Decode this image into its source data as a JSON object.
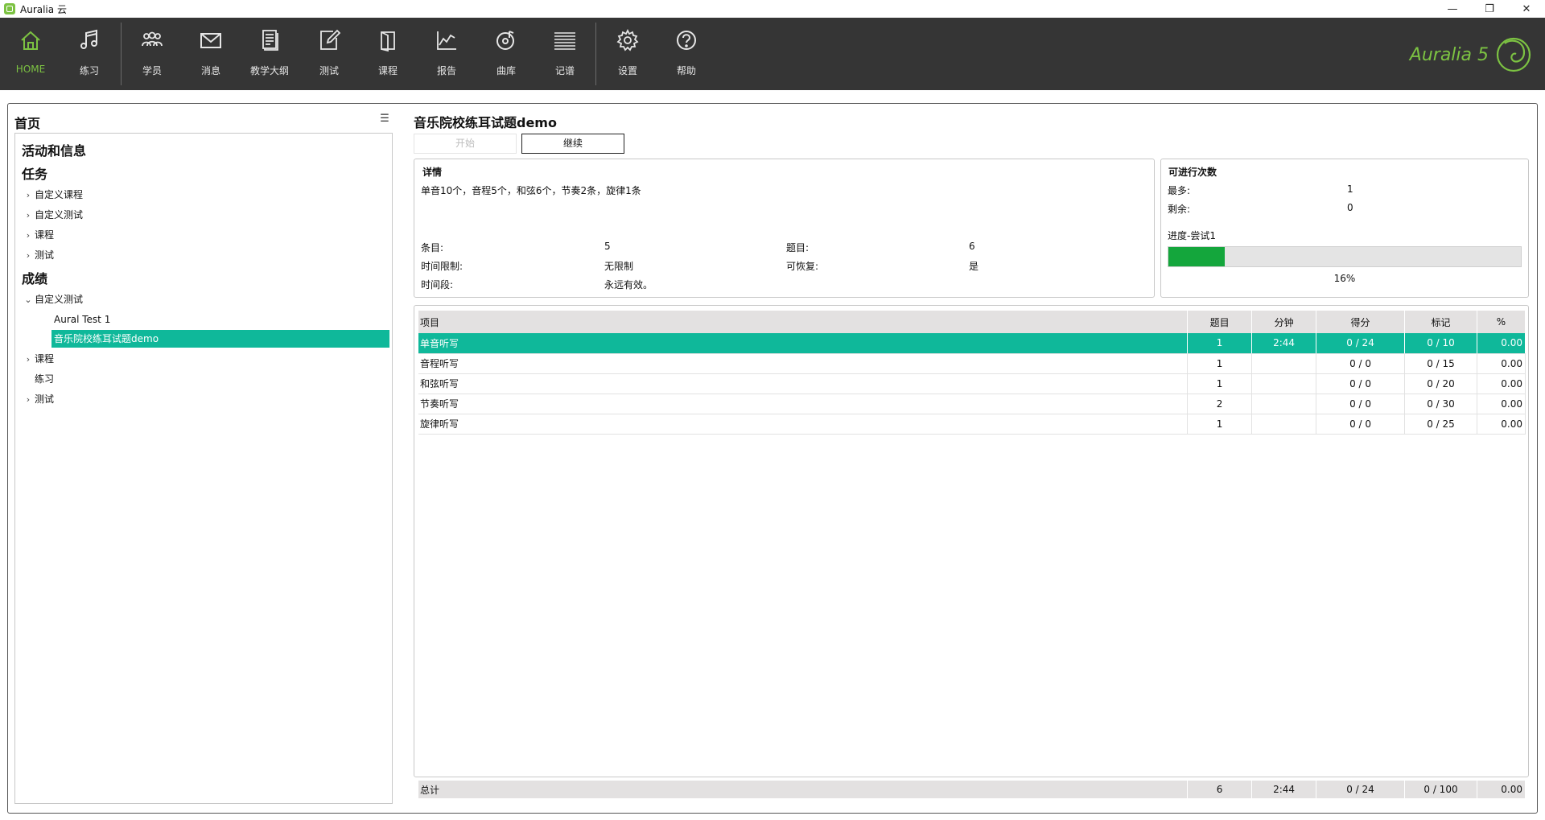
{
  "window": {
    "title": "Auralia 云"
  },
  "toolbar": {
    "items": [
      {
        "label": "HOME",
        "icon": "home-icon"
      },
      {
        "label": "练习",
        "icon": "music-note-icon"
      },
      {
        "label": "学员",
        "icon": "students-icon"
      },
      {
        "label": "消息",
        "icon": "mail-icon"
      },
      {
        "label": "教学大纲",
        "icon": "syllabus-icon"
      },
      {
        "label": "测试",
        "icon": "test-edit-icon"
      },
      {
        "label": "课程",
        "icon": "book-icon"
      },
      {
        "label": "报告",
        "icon": "chart-icon"
      },
      {
        "label": "曲库",
        "icon": "disc-icon"
      },
      {
        "label": "记谱",
        "icon": "staff-icon"
      },
      {
        "label": "设置",
        "icon": "gear-icon"
      },
      {
        "label": "帮助",
        "icon": "help-icon"
      }
    ],
    "brand": "Auralia 5",
    "accent": "#7cc242"
  },
  "left": {
    "title": "首页",
    "tree": {
      "section_activity": "活动和信息",
      "section_tasks": "任务",
      "task_items": [
        "自定义课程",
        "自定义测试",
        "课程",
        "测试"
      ],
      "section_results": "成绩",
      "results_custom_test": "自定义测试",
      "results_children": [
        "Aural Test 1",
        "音乐院校练耳试题demo"
      ],
      "results_items": [
        "课程",
        "练习",
        "测试"
      ]
    }
  },
  "right": {
    "title": "音乐院校练耳试题demo",
    "btn_start": "开始",
    "btn_continue": "继续",
    "details": {
      "title": "详情",
      "description": "单音10个，音程5个，和弦6个，节奏2条，旋律1条",
      "items_label": "条目:",
      "items_value": "5",
      "questions_label": "题目:",
      "questions_value": "6",
      "timelimit_label": "时间限制:",
      "timelimit_value": "无限制",
      "resumable_label": "可恢复:",
      "resumable_value": "是",
      "period_label": "时间段:",
      "period_value": "永远有效。"
    },
    "attempts": {
      "title": "可进行次数",
      "max_label": "最多:",
      "max_value": "1",
      "remaining_label": "剩余:",
      "remaining_value": "0",
      "progress_label": "进度-尝试1",
      "progress_fraction": 0.16,
      "progress_text": "16%"
    },
    "table": {
      "headers": [
        "项目",
        "题目",
        "分钟",
        "得分",
        "标记",
        "%"
      ],
      "rows": [
        [
          "单音听写",
          "1",
          "2:44",
          "0 / 24",
          "0 / 10",
          "0.00"
        ],
        [
          "音程听写",
          "1",
          "",
          "0 / 0",
          "0 / 15",
          "0.00"
        ],
        [
          "和弦听写",
          "1",
          "",
          "0 / 0",
          "0 / 20",
          "0.00"
        ],
        [
          "节奏听写",
          "2",
          "",
          "0 / 0",
          "0 / 30",
          "0.00"
        ],
        [
          "旋律听写",
          "1",
          "",
          "0 / 0",
          "0 / 25",
          "0.00"
        ]
      ],
      "total": [
        "总计",
        "6",
        "2:44",
        "0 / 24",
        "0 / 100",
        "0.00"
      ]
    },
    "selection_color": "#0fb89a"
  }
}
